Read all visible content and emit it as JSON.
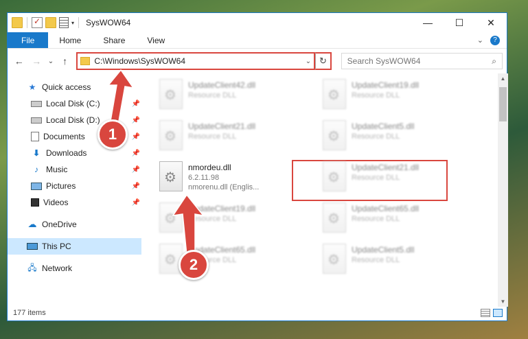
{
  "window": {
    "title": "SysWOW64",
    "controls": [
      "—",
      "☐",
      "✕"
    ]
  },
  "ribbon": {
    "tabs": [
      "File",
      "Home",
      "Share",
      "View"
    ],
    "expand_glyph": "⌄",
    "help_glyph": "?"
  },
  "nav": {
    "back": "←",
    "forward": "→",
    "recent": "⌄",
    "up": "↑"
  },
  "address": {
    "path": "C:\\Windows\\SysWOW64",
    "dropdown": "⌄",
    "refresh": "↻"
  },
  "search": {
    "placeholder": "Search SysWOW64",
    "icon": "⌕"
  },
  "sidebar": {
    "quick_access": "Quick access",
    "items": [
      {
        "label": "Local Disk (C:)",
        "icon": "disk-icon"
      },
      {
        "label": "Local Disk (D:)",
        "icon": "disk-icon"
      },
      {
        "label": "Documents",
        "icon": "documents-icon"
      },
      {
        "label": "Downloads",
        "icon": "downloads-icon"
      },
      {
        "label": "Music",
        "icon": "music-icon"
      },
      {
        "label": "Pictures",
        "icon": "pictures-icon"
      },
      {
        "label": "Videos",
        "icon": "videos-icon"
      }
    ],
    "onedrive": "OneDrive",
    "this_pc": "This PC",
    "network": "Network"
  },
  "files": {
    "left": [
      {
        "name": "UpdateClient42.dll",
        "sub": "Resource DLL"
      },
      {
        "name": "UpdateClient21.dll",
        "sub": "Resource DLL"
      },
      {
        "name": "UpdateClient19.dll",
        "sub": "Resource DLL"
      },
      {
        "name": "UpdateClient65.dll",
        "sub": "Resource DLL"
      }
    ],
    "highlighted": {
      "name": "nmordeu.dll",
      "version": "6.2.11.98",
      "description": "nmorenu.dll (Englis..."
    },
    "right": [
      {
        "name": "UpdateClient19.dll",
        "sub": "Resource DLL"
      },
      {
        "name": "UpdateClient5.dll",
        "sub": "Resource DLL"
      },
      {
        "name": "UpdateClient21.dll",
        "sub": "Resource DLL"
      },
      {
        "name": "UpdateClient65.dll",
        "sub": "Resource DLL"
      },
      {
        "name": "UpdateClient5.dll",
        "sub": "Resource DLL"
      }
    ]
  },
  "status": {
    "count": "177 items"
  },
  "callouts": {
    "one": "1",
    "two": "2"
  },
  "colors": {
    "accent": "#1979ca",
    "annotation": "#d9463e",
    "selected": "#cce8ff"
  }
}
